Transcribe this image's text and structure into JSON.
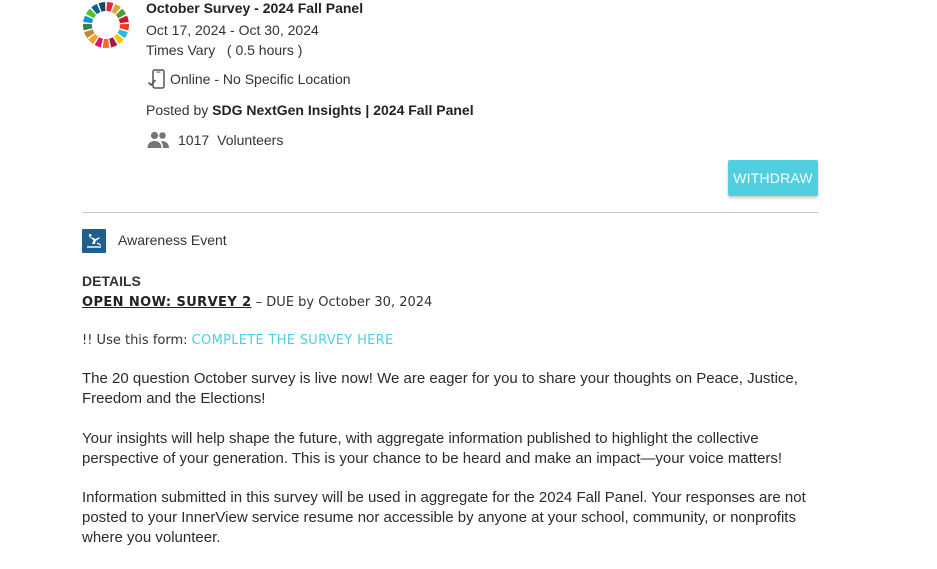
{
  "event": {
    "title": "October Survey - 2024 Fall Panel",
    "dates": "Oct 17, 2024 - Oct 30, 2024",
    "times": "Times Vary   ( 0.5 hours )",
    "location": "Online - No Specific Location",
    "posted_prefix": "Posted by ",
    "posted_org": "SDG NextGen Insights | 2024 Fall Panel",
    "volunteer_count": "1017",
    "volunteer_label": "Volunteers",
    "withdraw_label": "WITHDRAW"
  },
  "category": {
    "label": "Awareness Event",
    "icon": "awareness-icon"
  },
  "details": {
    "heading": "DETAILS",
    "open_now_link": "OPEN NOW: SURVEY 2",
    "due_text": " – DUE by October 30, 2024",
    "form_prefix": "!! Use this form: ",
    "form_link": "COMPLETE THE SURVEY HERE",
    "paragraphs": [
      "The 20 question October survey is live now! We are eager for you to share your thoughts on Peace, Justice, Freedom and the Elections!",
      "Your insights will help shape the future, with aggregate information published to highlight the collective perspective of your generation. This is your chance to be heard and make an impact—your voice matters!",
      "Information submitted in this survey will be used in aggregate for the 2024 Fall Panel.  Your responses are not posted to your InnerView service resume nor accessible by anyone at your school, community, or nonprofits where you volunteer."
    ]
  },
  "colors": {
    "accent": "#4fcfe0",
    "category_icon_bg": "#1e5f8f",
    "sdg_wheel": [
      "#e5243b",
      "#dda63a",
      "#4c9f38",
      "#c5192d",
      "#ff3a21",
      "#26bde2",
      "#fcc30b",
      "#a21942",
      "#fd6925",
      "#dd1367",
      "#fd9d24",
      "#bf8b2e",
      "#3f7e44",
      "#0a97d9",
      "#56c02b",
      "#00689d",
      "#19486a"
    ]
  }
}
